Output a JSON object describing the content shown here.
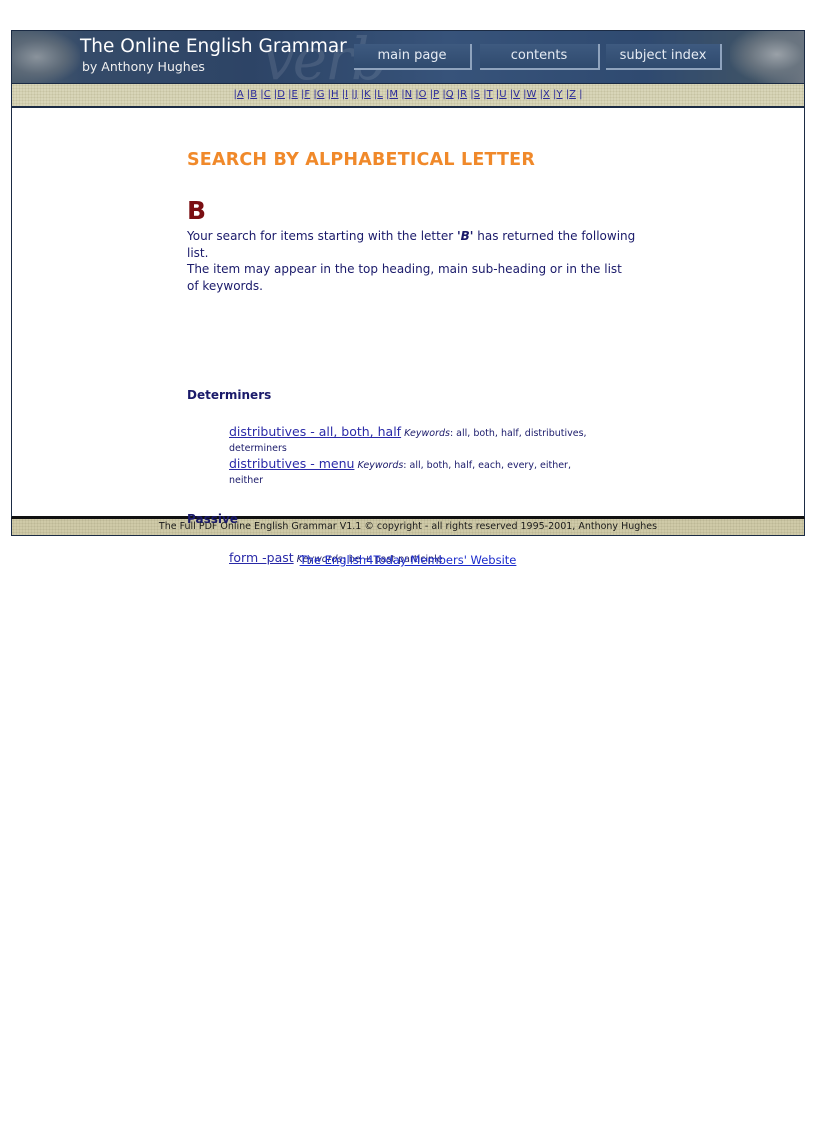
{
  "header": {
    "title": "The Online English Grammar",
    "author": "by Anthony Hughes",
    "decor_text": "verb",
    "nav": {
      "main_page": "main page",
      "contents": "contents",
      "subject_index": "subject index"
    }
  },
  "alphabet": [
    "A",
    "B",
    "C",
    "D",
    "E",
    "F",
    "G",
    "H",
    "I",
    "J",
    "K",
    "L",
    "M",
    "N",
    "O",
    "P",
    "Q",
    "R",
    "S",
    "T",
    "U",
    "V",
    "W",
    "X",
    "Y",
    "Z"
  ],
  "main": {
    "heading": "SEARCH BY ALPHABETICAL LETTER",
    "letter": "B",
    "intro_prefix": "Your search for items starting with the letter ",
    "intro_letter": "'B'",
    "intro_suffix": " has returned the following list.",
    "intro_line2": "The item may appear in the top heading, main sub-heading or in the list of keywords.",
    "keywords_label": "Keywords",
    "sections": [
      {
        "title": "Determiners",
        "items": [
          {
            "link": "distributives - all, both, half",
            "keywords": ": all, both, half, distributives, determiners"
          },
          {
            "link": "distributives - menu",
            "keywords": ": all, both, half, each, every, either, neither"
          }
        ]
      },
      {
        "title": "Passive",
        "items": [
          {
            "link": "form -past",
            "keywords": ": be + past participle"
          }
        ]
      }
    ]
  },
  "footer": {
    "text": "The Full PDF Online English Grammar V1.1 © copyright - all rights reserved 1995-2001, Anthony Hughes"
  },
  "bottom_link": "The English4Today Members' Website",
  "colors": {
    "heading": "#f0892a",
    "letter": "#7a0e12",
    "text": "#1a1a6a",
    "link": "#2a2aa8",
    "banner": "#2d4466",
    "strip": "#d8d5b8"
  }
}
